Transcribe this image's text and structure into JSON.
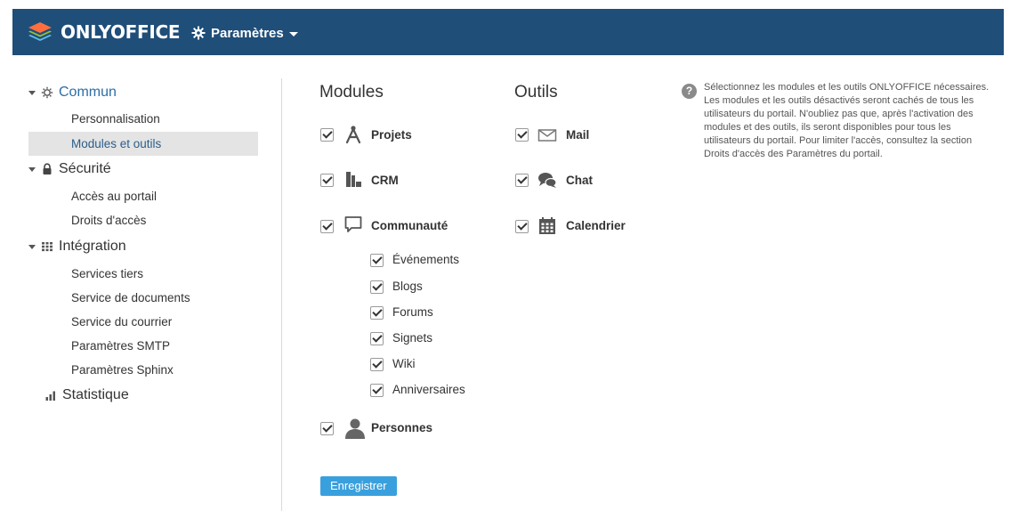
{
  "header": {
    "brand": "ONLYOFFICE",
    "menu_label": "Paramètres"
  },
  "sidebar": {
    "sections": [
      {
        "label": "Commun",
        "icon": "gear-icon",
        "expanded": true,
        "active": true
      },
      {
        "label": "Sécurité",
        "icon": "lock-icon",
        "expanded": true
      },
      {
        "label": "Intégration",
        "icon": "grid-icon",
        "expanded": true
      },
      {
        "label": "Statistique",
        "icon": "bar-chart-icon",
        "expanded": false
      }
    ],
    "items": [
      {
        "label": "Personnalisation",
        "section": "Commun"
      },
      {
        "label": "Modules et outils",
        "section": "Commun",
        "selected": true
      },
      {
        "label": "Accès au portail",
        "section": "Sécurité"
      },
      {
        "label": "Droits d'accès",
        "section": "Sécurité"
      },
      {
        "label": "Services tiers",
        "section": "Intégration"
      },
      {
        "label": "Service de documents",
        "section": "Intégration"
      },
      {
        "label": "Service du courrier",
        "section": "Intégration"
      },
      {
        "label": "Paramètres SMTP",
        "section": "Intégration"
      },
      {
        "label": "Paramètres Sphinx",
        "section": "Intégration"
      }
    ]
  },
  "modules": {
    "title": "Modules",
    "items": [
      {
        "label": "Projets",
        "checked": true,
        "icon": "compass-icon"
      },
      {
        "label": "CRM",
        "checked": true,
        "icon": "buildings-icon"
      },
      {
        "label": "Communauté",
        "checked": true,
        "icon": "speech-bubble-icon"
      },
      {
        "label": "Personnes",
        "checked": true,
        "icon": "person-icon"
      }
    ],
    "community_subitems": [
      {
        "label": "Événements",
        "checked": true
      },
      {
        "label": "Blogs",
        "checked": true
      },
      {
        "label": "Forums",
        "checked": true
      },
      {
        "label": "Signets",
        "checked": true
      },
      {
        "label": "Wiki",
        "checked": true
      },
      {
        "label": "Anniversaires",
        "checked": true
      }
    ]
  },
  "tools": {
    "title": "Outils",
    "items": [
      {
        "label": "Mail",
        "checked": true,
        "icon": "envelope-icon"
      },
      {
        "label": "Chat",
        "checked": true,
        "icon": "chat-bubbles-icon"
      },
      {
        "label": "Calendrier",
        "checked": true,
        "icon": "calendar-icon"
      }
    ]
  },
  "save_label": "Enregistrer",
  "help": {
    "icon": "?",
    "text": "Sélectionnez les modules et les outils ONLYOFFICE nécessaires. Les modules et les outils désactivés seront cachés de tous les utilisateurs du portail. N'oubliez pas que, après l'activation des modules et des outils, ils seront disponibles pour tous les utilisateurs du portail. Pour limiter l'accès, consultez la section Droits d'accès des Paramètres du portail."
  },
  "colors": {
    "header_bg": "#1f4e79",
    "accent": "#2c6ea6",
    "button": "#3aa0dd",
    "selected_bg": "#e4e4e4"
  }
}
